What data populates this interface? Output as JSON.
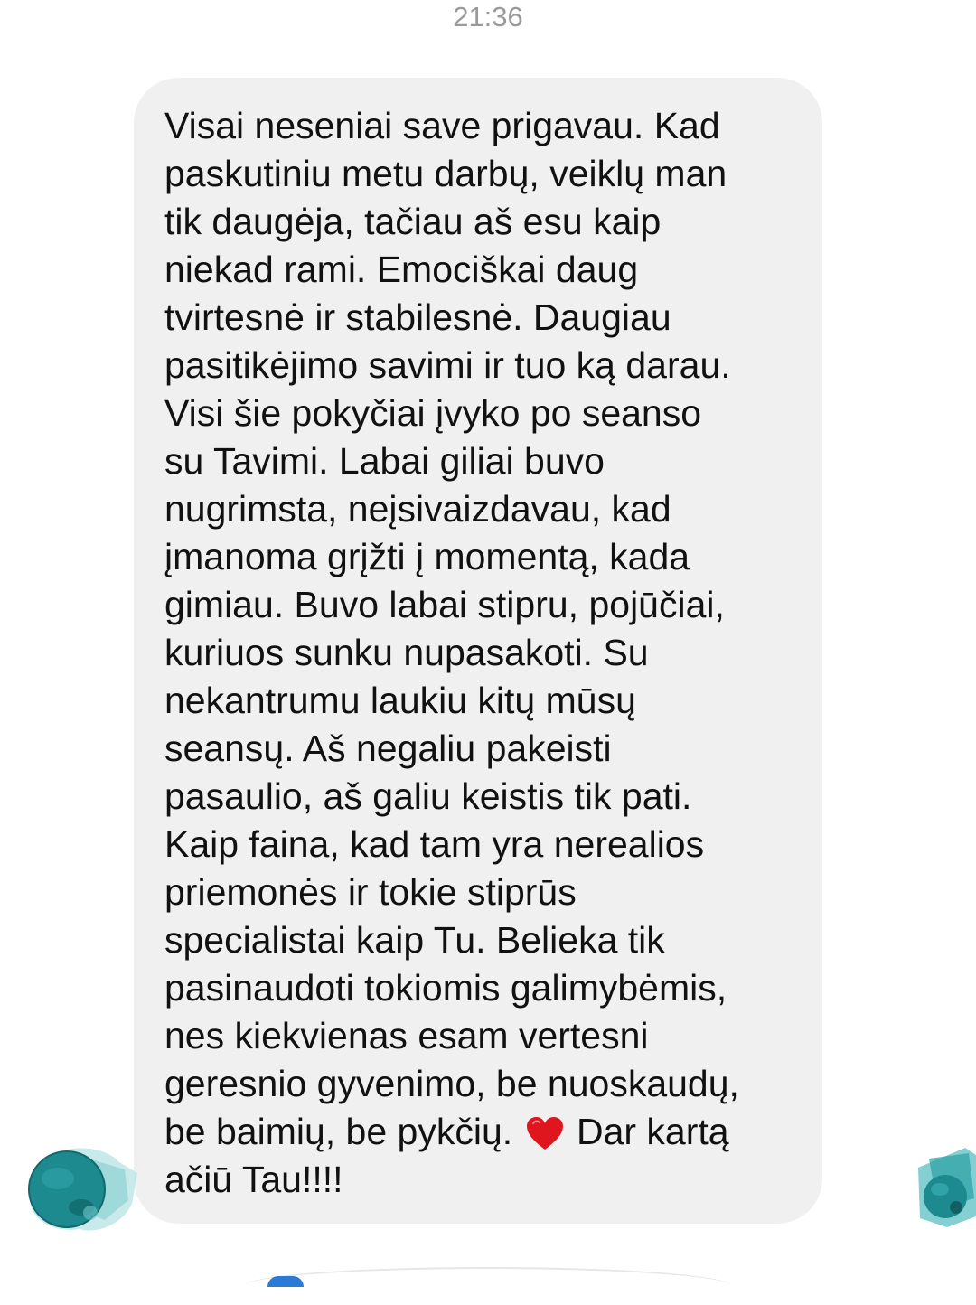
{
  "header": {
    "timestamp": "21:36"
  },
  "message": {
    "lines": [
      "Visai neseniai save prigavau. Kad",
      "paskutiniu metu darbų, veiklų man",
      "tik daugėja, tačiau aš esu kaip",
      "niekad rami. Emociškai daug",
      "tvirtesnė ir stabilesnė. Daugiau",
      "pasitikėjimo savimi ir tuo ką darau.",
      "Visi šie pokyčiai įvyko po seanso",
      "su Tavimi. Labai giliai buvo",
      "nugrimsta, neįsivaizdavau, kad",
      "įmanoma grįžti į momentą, kada",
      "gimiau. Buvo labai stipru, pojūčiai,",
      "kuriuos sunku nupasakoti. Su",
      "nekantrumu laukiu kitų mūsų",
      "seansų. Aš negaliu pakeisti",
      "pasaulio, aš galiu keistis tik pati.",
      "Kaip faina, kad tam yra nerealios",
      "priemonės ir tokie stiprūs",
      "specialistai kaip Tu. Belieka tik",
      "pasinaudoti tokiomis galimybėmis,",
      "nes kiekvienas esam vertesni",
      "geresnio gyvenimo, be nuoskaudų,"
    ],
    "line_22_before_heart": "be baimių, be pykčių.",
    "line_22_after_heart": "Dar kartą",
    "last_line": "ačiū Tau!!!!",
    "heart_icon": "heart-icon",
    "bubble_color": "#f0f0f0",
    "heart_color": "#e0161e"
  },
  "avatars": {
    "sender_icon": "avatar-teal-circle",
    "read_receipt_icon": "avatar-teal-square",
    "accent": "#1c8a8f"
  }
}
